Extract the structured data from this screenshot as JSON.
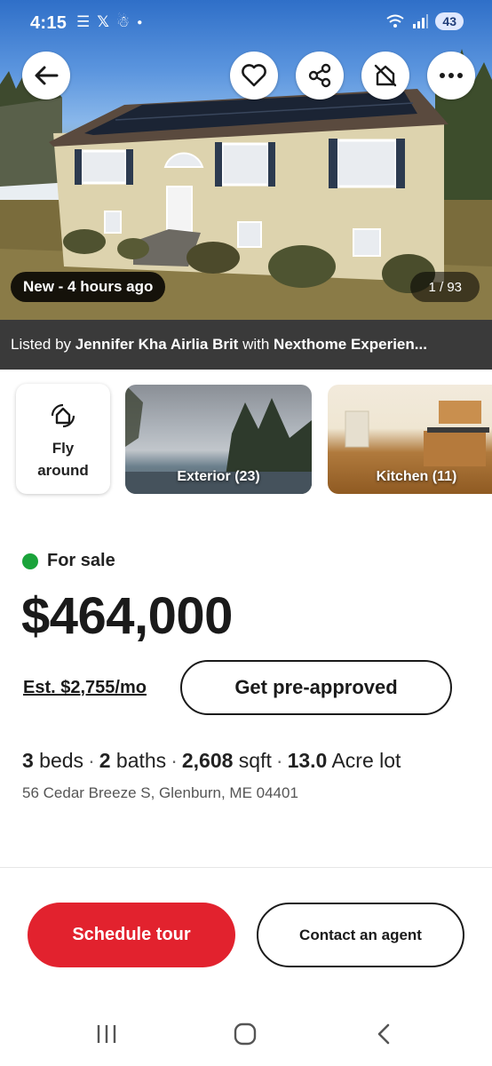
{
  "status_bar": {
    "time": "4:15",
    "left_icons": [
      "E",
      "X",
      "notification-icon",
      "dot-icon"
    ],
    "battery": "43"
  },
  "hero": {
    "new_badge": "New - 4 hours ago",
    "photo_counter": "1 / 93",
    "actions": [
      "back-icon",
      "heart-icon",
      "share-icon",
      "hide-icon",
      "more-icon"
    ]
  },
  "listed_by": {
    "prefix": "Listed by ",
    "agent": "Jennifer Kha Airlia Brit",
    "with": " with ",
    "brokerage": "Nexthome Experien..."
  },
  "media": {
    "fly_around": "Fly\naround",
    "exterior": "Exterior (23)",
    "kitchen": "Kitchen (11)"
  },
  "listing": {
    "status": "For sale",
    "status_color": "#1aa33a",
    "price": "$464,000",
    "estimate": "Est. $2,755/mo",
    "preapproved_label": "Get pre-approved",
    "beds_num": "3",
    "beds_label": " beds",
    "baths_num": "2",
    "baths_label": " baths",
    "sqft_num": "2,608",
    "sqft_label": " sqft",
    "lot_num": "13.0",
    "lot_label": " Acre lot",
    "address": "56 Cedar Breeze S, Glenburn, ME 04401"
  },
  "cta": {
    "schedule_label": "Schedule tour",
    "contact_label": "Contact an agent",
    "primary_color": "#e2222e"
  }
}
